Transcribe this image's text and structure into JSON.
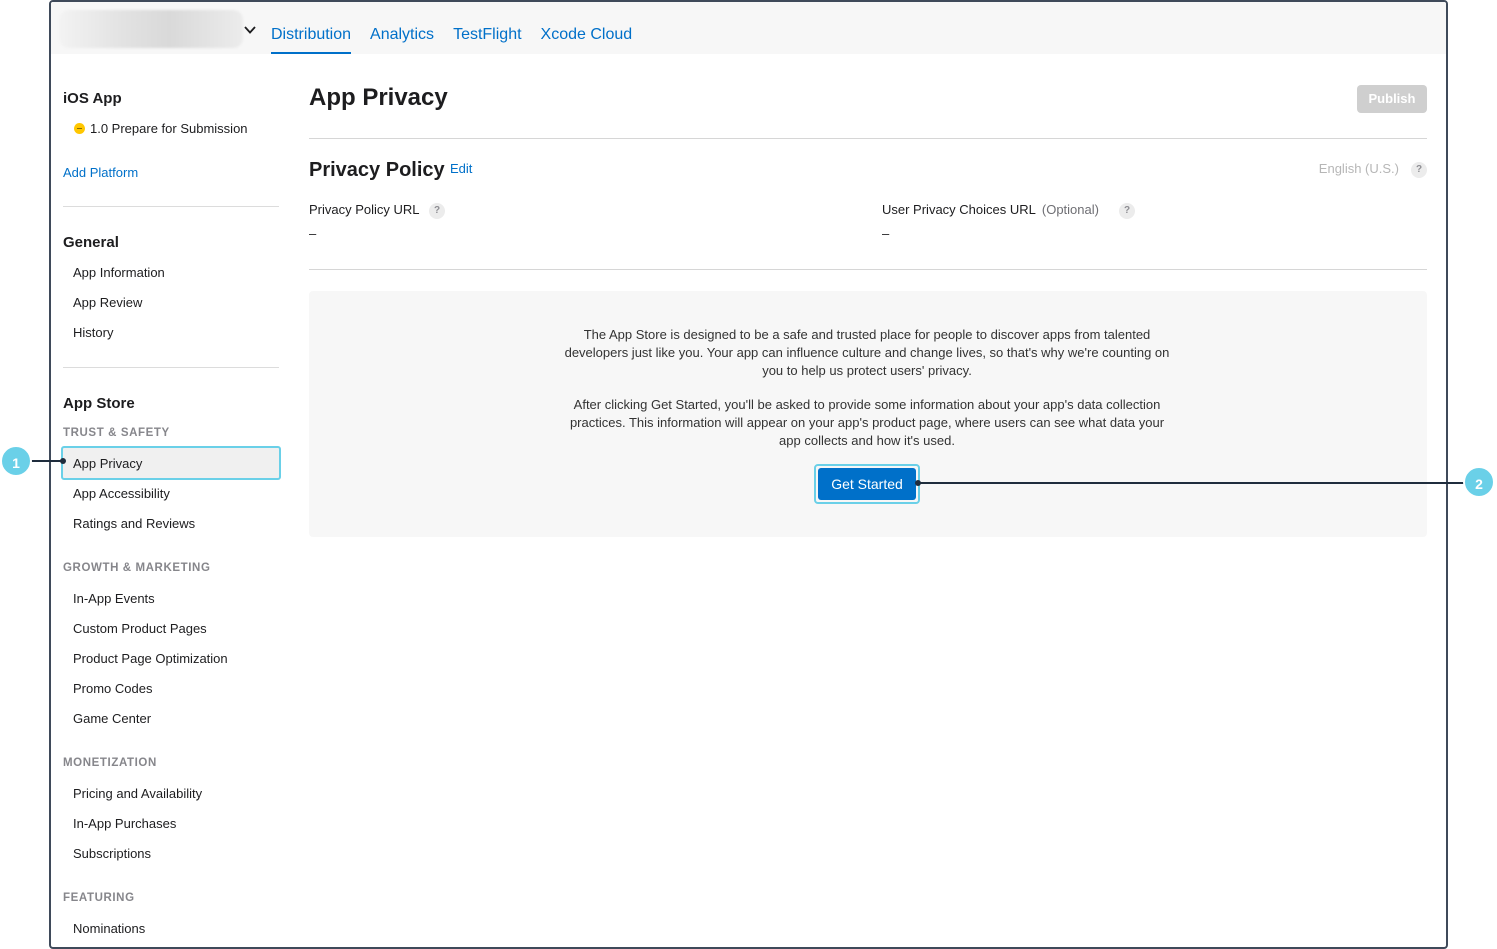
{
  "nav": {
    "tabs": [
      {
        "label": "Distribution",
        "active": true
      },
      {
        "label": "Analytics",
        "active": false
      },
      {
        "label": "TestFlight",
        "active": false
      },
      {
        "label": "Xcode Cloud",
        "active": false
      }
    ]
  },
  "sidebar": {
    "platform_title": "iOS App",
    "version_status": "1.0 Prepare for Submission",
    "add_platform": "Add Platform",
    "general_heading": "General",
    "general_items": [
      "App Information",
      "App Review",
      "History"
    ],
    "appstore_heading": "App Store",
    "groups": [
      {
        "title": "TRUST & SAFETY",
        "items": [
          "App Privacy",
          "App Accessibility",
          "Ratings and Reviews"
        ]
      },
      {
        "title": "GROWTH & MARKETING",
        "items": [
          "In-App Events",
          "Custom Product Pages",
          "Product Page Optimization",
          "Promo Codes",
          "Game Center"
        ]
      },
      {
        "title": "MONETIZATION",
        "items": [
          "Pricing and Availability",
          "In-App Purchases",
          "Subscriptions"
        ]
      },
      {
        "title": "FEATURING",
        "items": [
          "Nominations"
        ]
      }
    ],
    "selected_item": "App Privacy"
  },
  "main": {
    "title": "App Privacy",
    "publish_label": "Publish",
    "privacy_policy": {
      "title": "Privacy Policy",
      "edit_label": "Edit",
      "language": "English (U.S.)",
      "help_glyph": "?",
      "policy_url_label": "Privacy Policy URL",
      "policy_url_value": "–",
      "choices_url_label": "User Privacy Choices URL",
      "choices_url_optional": "(Optional)",
      "choices_url_value": "–"
    },
    "info": {
      "paragraph1": "The App Store is designed to be a safe and trusted place for people to discover apps from talented developers just like you. Your app can influence culture and change lives, so that's why we're counting on you to help us protect users' privacy.",
      "paragraph2": "After clicking Get Started, you'll be asked to provide some information about your app's data collection practices. This information will appear on your app's product page, where users can see what data your app collects and how it's used.",
      "cta_label": "Get Started"
    }
  },
  "callouts": [
    "1",
    "2"
  ],
  "colors": {
    "accent": "#0070c9",
    "highlight": "#6ad0e8",
    "status_dot": "#ffc700",
    "disabled_button": "#cfcfcf"
  },
  "icons": {
    "app_switcher_chevron": "chevron-down-icon",
    "status": "status-dot-icon",
    "help": "help-icon"
  }
}
